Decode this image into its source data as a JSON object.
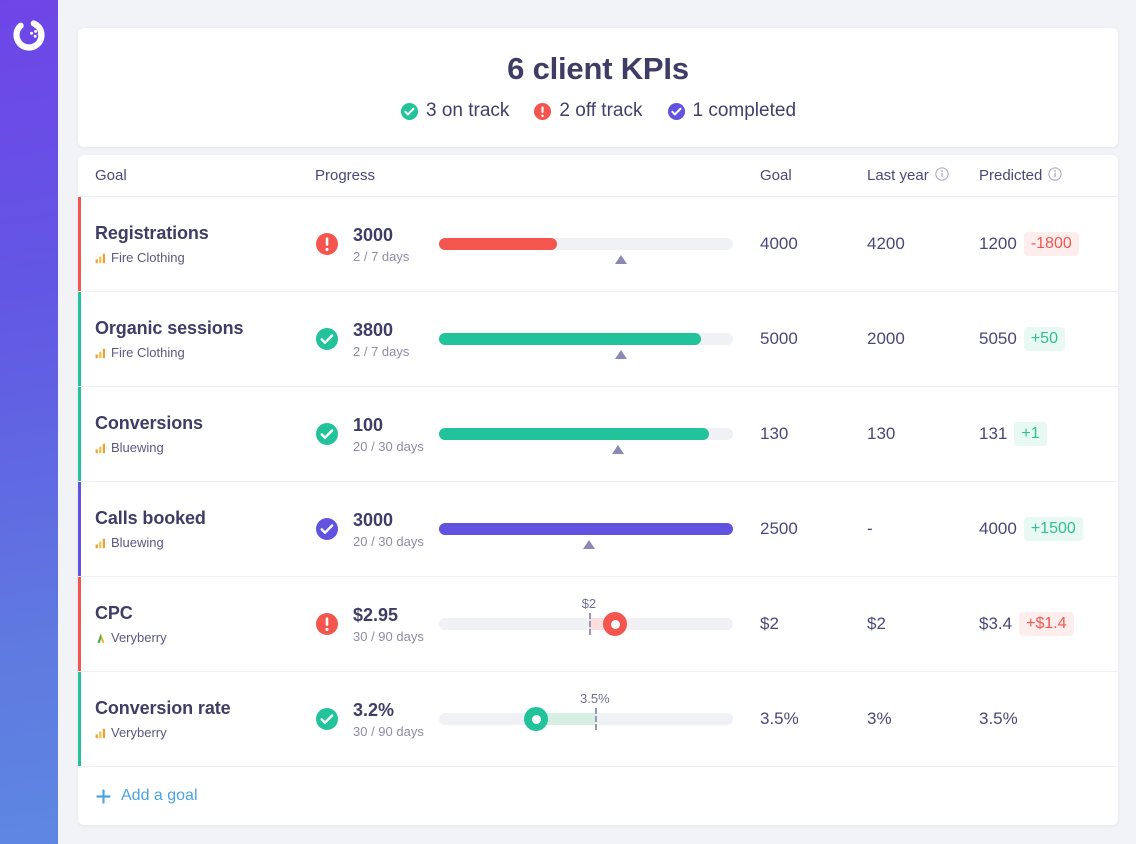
{
  "brand": {
    "logo_name": "databox-logo",
    "sidebar_gradient_from": "#6f45e8",
    "sidebar_gradient_to": "#5e87e2"
  },
  "header": {
    "title": "6 client KPIs",
    "summary": [
      {
        "icon": "check-circle-icon",
        "label": "3 on track",
        "color": "#22c39a"
      },
      {
        "icon": "exclamation-circle-icon",
        "label": "2 off track",
        "color": "#f4564f"
      },
      {
        "icon": "check-circle-icon",
        "label": "1 completed",
        "color": "#6152e0"
      }
    ]
  },
  "table": {
    "columns": {
      "goal": "Goal",
      "progress": "Progress",
      "target": "Goal",
      "last_year": "Last year",
      "predicted": "Predicted"
    },
    "rows": [
      {
        "name": "Registrations",
        "client": "Fire Clothing",
        "client_icon": "bar-chart-icon",
        "status": "off-track",
        "status_icon": "exclamation-circle-icon",
        "status_color": "#f4564f",
        "current": "3000",
        "days": "2 / 7 days",
        "bar_type": "fill",
        "fill_percent": 40,
        "marker_percent": 62,
        "target": "4000",
        "last_year": "4200",
        "predicted": "1200",
        "delta": "-1800",
        "delta_sign": "neg"
      },
      {
        "name": "Organic sessions",
        "client": "Fire Clothing",
        "client_icon": "bar-chart-icon",
        "status": "on-track",
        "status_icon": "check-circle-icon",
        "status_color": "#22c39a",
        "current": "3800",
        "days": "2 / 7 days",
        "bar_type": "fill",
        "fill_percent": 89,
        "marker_percent": 62,
        "target": "5000",
        "last_year": "2000",
        "predicted": "5050",
        "delta": "+50",
        "delta_sign": "pos"
      },
      {
        "name": "Conversions",
        "client": "Bluewing",
        "client_icon": "bar-chart-icon",
        "status": "on-track",
        "status_icon": "check-circle-icon",
        "status_color": "#22c39a",
        "current": "100",
        "days": "20 / 30 days",
        "bar_type": "fill",
        "fill_percent": 92,
        "marker_percent": 61,
        "target": "130",
        "last_year": "130",
        "predicted": "131",
        "delta": "+1",
        "delta_sign": "pos"
      },
      {
        "name": "Calls booked",
        "client": "Bluewing",
        "client_icon": "bar-chart-icon",
        "status": "completed",
        "status_icon": "check-circle-icon",
        "status_color": "#6152e0",
        "current": "3000",
        "days": "20 / 30 days",
        "bar_type": "fill",
        "fill_percent": 100,
        "marker_percent": 51,
        "target": "2500",
        "last_year": "-",
        "predicted": "4000",
        "delta": "+1500",
        "delta_sign": "pos"
      },
      {
        "name": "CPC",
        "client": "Veryberry",
        "client_icon": "analytics-icon",
        "status": "off-track",
        "status_icon": "exclamation-circle-icon",
        "status_color": "#f4564f",
        "current": "$2.95",
        "days": "30 / 90 days",
        "bar_type": "slider",
        "dash_percent": 51,
        "knob_percent": 60,
        "dash_label": "$2",
        "band_color": "#fcdedd",
        "knob_color": "#f4564f",
        "target": "$2",
        "last_year": "$2",
        "predicted": "$3.4",
        "delta": "+$1.4",
        "delta_sign": "neg"
      },
      {
        "name": "Conversion rate",
        "client": "Veryberry",
        "client_icon": "bar-chart-icon",
        "status": "on-track",
        "status_icon": "check-circle-icon",
        "status_color": "#22c39a",
        "current": "3.2%",
        "days": "30 / 90 days",
        "bar_type": "slider",
        "dash_percent": 53,
        "knob_percent": 33,
        "dash_label": "3.5%",
        "band_color": "#d6efe5",
        "knob_color": "#22c39a",
        "target": "3.5%",
        "last_year": "3%",
        "predicted": "3.5%",
        "delta": "",
        "delta_sign": "none"
      }
    ],
    "footer": {
      "add_label": "Add a goal",
      "add_icon": "plus-icon"
    }
  }
}
